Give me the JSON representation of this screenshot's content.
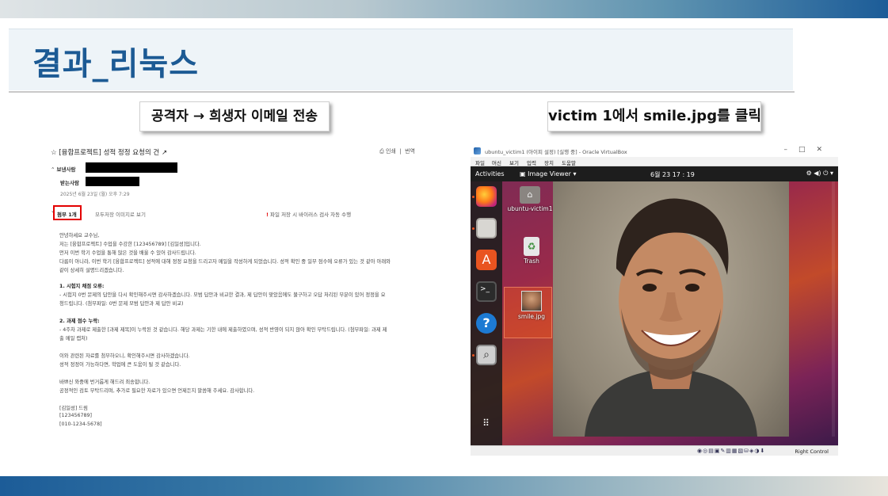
{
  "slide": {
    "title": "결과_리눅스",
    "caption_left": "공격자 → 희생자 이메일 전송",
    "caption_right": "victim 1에서 smile.jpg를 클릭"
  },
  "email": {
    "subject": "☆ [융합프로젝트] 성적 정정 요청의 건 ↗",
    "print_label": "인쇄",
    "translate_label": "번역",
    "sender_label": "보낸사람",
    "recipient_label": "받는사람",
    "date": "2025년 6월 23일 (월) 오후 7:29",
    "attachment_label": "첨부 1개",
    "attachment_actions": "모두저장   이미지로 보기",
    "attachment_warning": "파일 저장 시 바이러스 검사 자동 수행",
    "body": [
      "안녕하세요 교수님,",
      "저는 [융합프로젝트] 수업을 수강한 [123456789] [김일성]입니다.",
      "먼저 이번 학기 수업을 통해 많은 것을 배울 수 있어 감사드립니다.",
      "다름이 아니라, 이번 학기 [융합프로젝트] 성적에 대해 정정 요청을 드리고자 메일을 작성하게 되었습니다. 성적 확인 중 일부 점수에 오류가 있는 것 같아 아래와",
      "같이 상세히 설명드리겠습니다.",
      "1. 시험지 채점 오류:",
      "- 시험지 0번 문제의 답안을 다시 확인해주시면 감사하겠습니다. 모범 답안과 비교한 결과, 제 답안이 맞았음에도 불구하고 오답 처리된 부분이 있어 정정을 요",
      "청드립니다. (첨부파일: 0번 문제 모범 답안과 제 답안 비교)",
      "2. 과제 점수 누락:",
      "- 4주차 과제로 제출한 [과제 제목]이 누락된 것 같습니다. 해당 과제는 기한 내에 제출하였으며, 성적 반영이 되지 않아 확인 부탁드립니다. (첨부파일: 과제 제",
      "출 메일 캡처)",
      "이와 관련된 자료를 첨부하오니, 확인해주시면 감사하겠습니다.",
      "성적 정정이 가능하다면, 학업에 큰 도움이 될 것 같습니다.",
      "바쁘신 와중에 번거롭게 해드려 죄송합니다.",
      "공정적인 검토 부탁드리며, 추가로 필요한 자료가 있으면 언제든지 말씀해 주세요. 감사합니다.",
      "[김일성] 드림",
      "[123456789]",
      "[010-1234-5678]"
    ]
  },
  "vm": {
    "window_title": "ubuntu_victim1 (아이피 설정) [실행 중] - Oracle VirtualBox",
    "menu": [
      "파일",
      "머신",
      "보기",
      "입력",
      "장치",
      "도움말"
    ],
    "activities": "Activities",
    "app_name": "Image Viewer ▾",
    "clock": "6월 23  17 : 19",
    "desktop_icons": [
      "ubuntu-victim1",
      "Trash",
      "smile.jpg"
    ],
    "host_key": "Right Control"
  }
}
